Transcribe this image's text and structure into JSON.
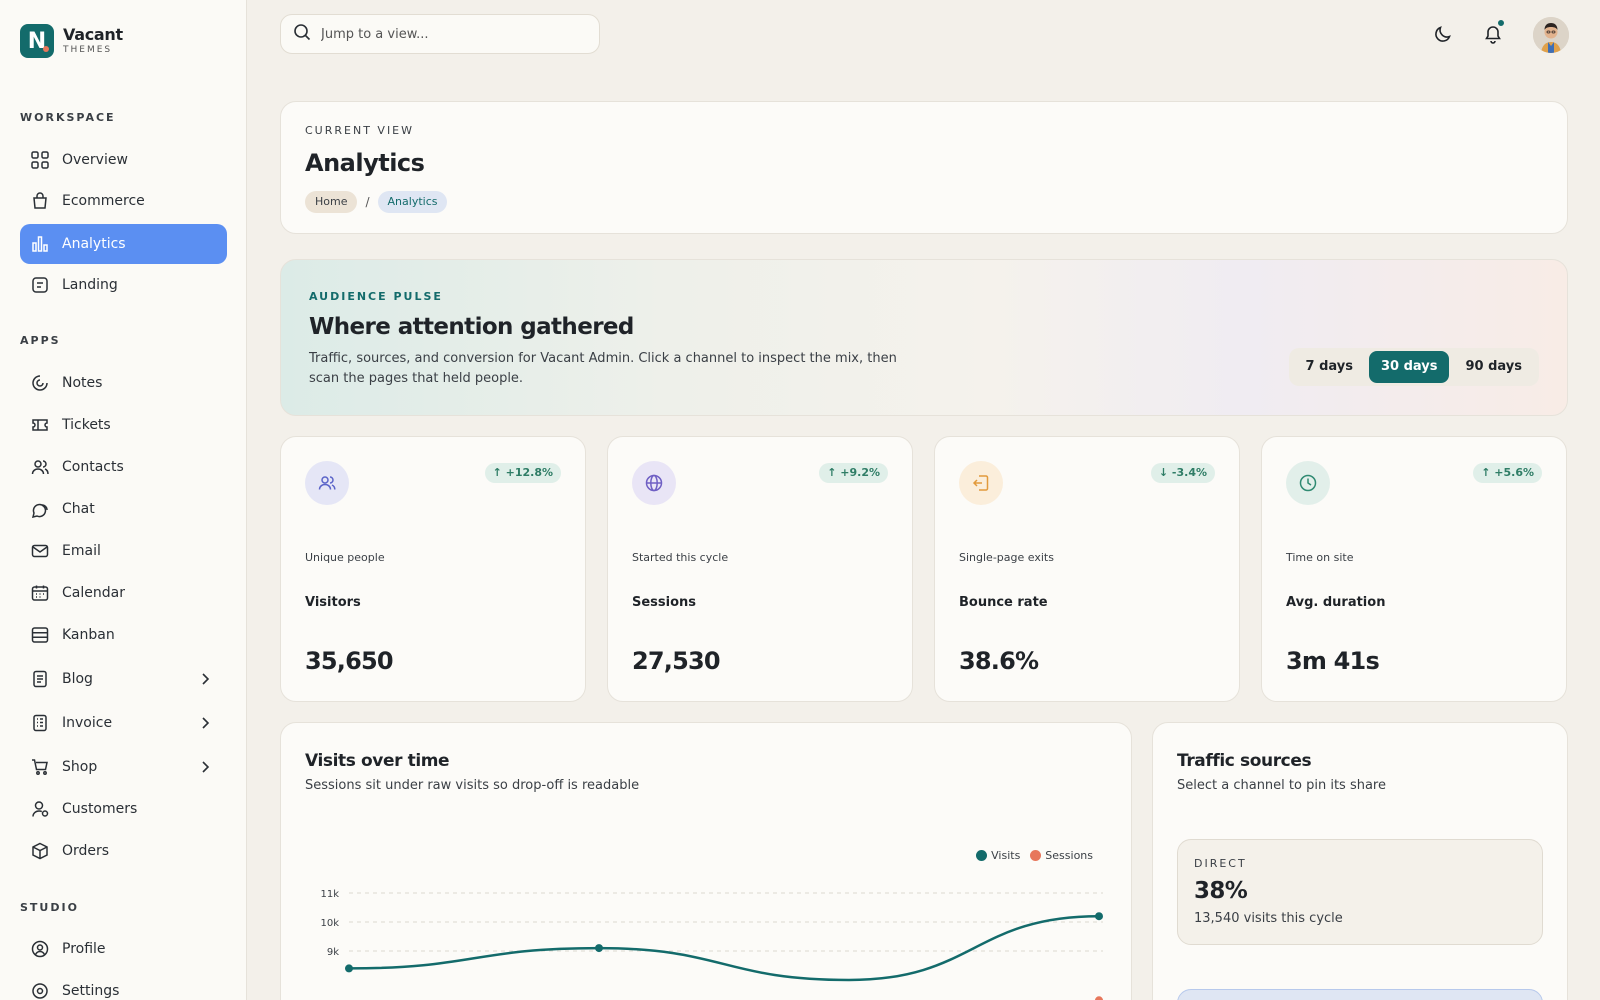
{
  "brand": {
    "name": "Vacant",
    "sub": "THEMES",
    "logo_letter": "N",
    "accent": "#136b6b"
  },
  "sidebar": {
    "sections": {
      "workspace": "WORKSPACE",
      "apps": "APPS",
      "studio": "STUDIO"
    },
    "workspace_items": [
      {
        "label": "Overview",
        "icon": "grid-icon"
      },
      {
        "label": "Ecommerce",
        "icon": "bag-icon"
      },
      {
        "label": "Analytics",
        "icon": "bar-chart-icon",
        "active": true
      },
      {
        "label": "Landing",
        "icon": "page-icon"
      }
    ],
    "apps_items": [
      {
        "label": "Notes",
        "icon": "notes-icon"
      },
      {
        "label": "Tickets",
        "icon": "ticket-icon"
      },
      {
        "label": "Contacts",
        "icon": "contacts-icon"
      },
      {
        "label": "Chat",
        "icon": "chat-icon"
      },
      {
        "label": "Email",
        "icon": "mail-icon"
      },
      {
        "label": "Calendar",
        "icon": "calendar-icon"
      },
      {
        "label": "Kanban",
        "icon": "kanban-icon"
      },
      {
        "label": "Blog",
        "icon": "blog-icon",
        "expandable": true
      },
      {
        "label": "Invoice",
        "icon": "invoice-icon",
        "expandable": true
      },
      {
        "label": "Shop",
        "icon": "cart-icon",
        "expandable": true
      },
      {
        "label": "Customers",
        "icon": "customers-icon"
      },
      {
        "label": "Orders",
        "icon": "box-icon"
      }
    ],
    "studio_items": [
      {
        "label": "Profile",
        "icon": "profile-icon"
      },
      {
        "label": "Settings",
        "icon": "settings-icon"
      }
    ]
  },
  "topbar": {
    "search_placeholder": "Jump to a view...",
    "theme_icon": "moon-icon",
    "notification_icon": "bell-icon"
  },
  "header": {
    "kicker": "CURRENT VIEW",
    "title": "Analytics",
    "breadcrumb": [
      "Home",
      "/",
      "Analytics"
    ]
  },
  "hero": {
    "kicker": "AUDIENCE PULSE",
    "title": "Where attention gathered",
    "description": "Traffic, sources, and conversion for Vacant Admin. Click a channel to inspect the mix, then scan the pages that held people.",
    "ranges": [
      "7 days",
      "30 days",
      "90 days"
    ],
    "active_range": "30 days"
  },
  "kpis": [
    {
      "sub": "Unique people",
      "label": "Visitors",
      "value": "35,650",
      "delta": "+12.8%",
      "trend": "up",
      "icon": "users-icon",
      "icon_bg": "#e5e6f6",
      "icon_color": "#5a63c8"
    },
    {
      "sub": "Started this cycle",
      "label": "Sessions",
      "value": "27,530",
      "delta": "+9.2%",
      "trend": "up",
      "icon": "globe-icon",
      "icon_bg": "#e9e5f6",
      "icon_color": "#6f5fc4"
    },
    {
      "sub": "Single-page exits",
      "label": "Bounce rate",
      "value": "38.6%",
      "delta": "-3.4%",
      "trend": "down",
      "icon": "exit-icon",
      "icon_bg": "#fbeedb",
      "icon_color": "#e29a3c"
    },
    {
      "sub": "Time on site",
      "label": "Avg. duration",
      "value": "3m 41s",
      "delta": "+5.6%",
      "trend": "up",
      "icon": "clock-icon",
      "icon_bg": "#e2efea",
      "icon_color": "#2f8a72"
    }
  ],
  "visits_chart": {
    "title": "Visits over time",
    "subtitle": "Sessions sit under raw visits so drop-off is readable"
  },
  "chart_data": {
    "type": "line",
    "x": [
      0,
      1,
      2,
      3
    ],
    "series": [
      {
        "name": "Visits",
        "color": "#136b6b",
        "values": [
          8400,
          9100,
          8000,
          10200
        ]
      },
      {
        "name": "Sessions",
        "color": "#e7775c",
        "values": [
          null,
          null,
          null,
          7300
        ]
      }
    ],
    "y_ticks": [
      "11k",
      "10k",
      "9k"
    ],
    "ylim": [
      7000,
      11000
    ],
    "grid": true,
    "legend": "top-right"
  },
  "traffic": {
    "title": "Traffic sources",
    "subtitle": "Select a channel to pin its share",
    "selected": {
      "kicker": "DIRECT",
      "share": "38%",
      "detail": "13,540 visits this cycle"
    }
  }
}
